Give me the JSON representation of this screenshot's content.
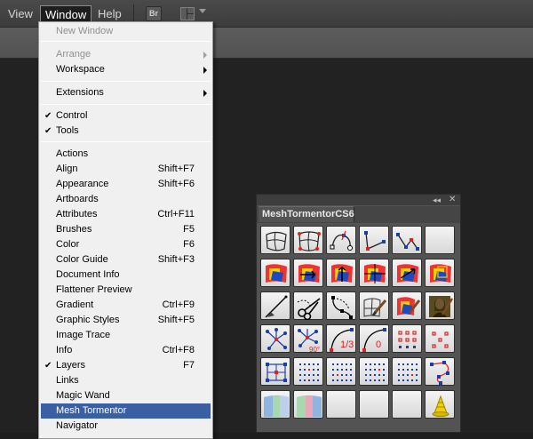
{
  "menubar": {
    "items": [
      {
        "label": "View"
      },
      {
        "label": "Window"
      },
      {
        "label": "Help"
      }
    ],
    "bridge_label": "Br"
  },
  "window_menu": {
    "items": [
      {
        "label": "New Window",
        "disabled": true
      },
      {
        "label": "Arrange",
        "disabled": true,
        "submenu": true
      },
      {
        "label": "Workspace",
        "submenu": true
      },
      {
        "label": "Extensions",
        "submenu": true
      },
      {
        "label": "Control",
        "checked": true
      },
      {
        "label": "Tools",
        "checked": true
      },
      {
        "label": "Actions"
      },
      {
        "label": "Align",
        "shortcut": "Shift+F7"
      },
      {
        "label": "Appearance",
        "shortcut": "Shift+F6"
      },
      {
        "label": "Artboards"
      },
      {
        "label": "Attributes",
        "shortcut": "Ctrl+F11"
      },
      {
        "label": "Brushes",
        "shortcut": "F5"
      },
      {
        "label": "Color",
        "shortcut": "F6"
      },
      {
        "label": "Color Guide",
        "shortcut": "Shift+F3"
      },
      {
        "label": "Document Info"
      },
      {
        "label": "Flattener Preview"
      },
      {
        "label": "Gradient",
        "shortcut": "Ctrl+F9"
      },
      {
        "label": "Graphic Styles",
        "shortcut": "Shift+F5"
      },
      {
        "label": "Image Trace"
      },
      {
        "label": "Info",
        "shortcut": "Ctrl+F8"
      },
      {
        "label": "Layers",
        "shortcut": "F7",
        "checked": true
      },
      {
        "label": "Links"
      },
      {
        "label": "Magic Wand"
      },
      {
        "label": "Mesh Tormentor",
        "highlighted": true
      },
      {
        "label": "Navigator"
      }
    ],
    "check_glyph": "✔"
  },
  "panel": {
    "title": "MeshTormentorCS6",
    "collapse_glyph": "◂◂",
    "close_glyph": "✕",
    "tool_rows": [
      [
        "warp-grid-icon",
        "warp-grid-red-icon",
        "node-path-icon",
        "node-path-corner-icon",
        "node-path-open-icon",
        "blank-icon"
      ],
      [
        "flag-warp-icon",
        "flag-arrow-right-icon",
        "flag-arrow-up-icon",
        "flag-grid-icon",
        "flag-arrows-icon",
        "flag-grid-yellow-icon"
      ],
      [
        "pen-line-icon",
        "scissors-icon",
        "dotted-curve-icon",
        "grid-brush-icon",
        "flag-brush-icon",
        "mona-lisa-icon"
      ],
      [
        "star-nodes-icon",
        "star-nodes-90-icon",
        "curve-one-third-icon",
        "curve-zero-icon",
        "dot-grid-red-icon",
        "dot-grid-sparse-icon"
      ],
      [
        "mesh-square-icon",
        "dot-grid-blue-icon",
        "dot-grid-blue-2-icon",
        "dot-grid-blue-3-icon",
        "dot-grid-blue-4-icon",
        "node-loop-icon"
      ],
      [
        "gradient-strips-icon",
        "gradient-strips-pink-icon",
        "blank-icon",
        "blank-icon",
        "blank-icon",
        "cone-icon"
      ]
    ],
    "labels": {
      "one_third": "1/3",
      "zero": "0",
      "ninety": "90°"
    }
  }
}
